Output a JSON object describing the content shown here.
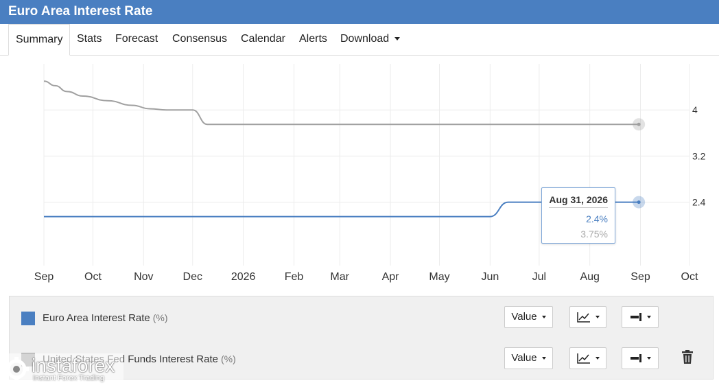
{
  "window": {
    "title": "Euro Area Interest Rate"
  },
  "tabs": [
    {
      "label": "Summary",
      "active": true
    },
    {
      "label": "Stats"
    },
    {
      "label": "Forecast"
    },
    {
      "label": "Consensus"
    },
    {
      "label": "Calendar"
    },
    {
      "label": "Alerts"
    },
    {
      "label": "Download",
      "has_dropdown": true
    }
  ],
  "chart_data": {
    "type": "line",
    "x_tick_labels": [
      "Sep",
      "Oct",
      "Nov",
      "Dec",
      "2026",
      "Feb",
      "Mar",
      "Apr",
      "May",
      "Jun",
      "Jul",
      "Aug",
      "Sep",
      "Oct"
    ],
    "y_tick_labels": [
      "4",
      "3.2",
      "2.4"
    ],
    "y_ticks": [
      4,
      3.2,
      2.4
    ],
    "ylim": [
      1.3,
      4.8
    ],
    "y_axis_side": "right",
    "grid": true,
    "series": [
      {
        "name": "Euro Area Interest Rate",
        "color": "#4a7fc1",
        "points": [
          [
            "2025-09-01",
            2.15
          ],
          [
            "2026-06-01",
            2.15
          ],
          [
            "2026-06-12",
            2.4
          ],
          [
            "2026-08-31",
            2.4
          ]
        ]
      },
      {
        "name": "United States Fed Funds Interest Rate",
        "color": "#a0a0a0",
        "points": [
          [
            "2025-09-01",
            4.5
          ],
          [
            "2025-09-08",
            4.42
          ],
          [
            "2025-09-15",
            4.32
          ],
          [
            "2025-09-25",
            4.24
          ],
          [
            "2025-10-10",
            4.16
          ],
          [
            "2025-10-25",
            4.08
          ],
          [
            "2025-11-05",
            4.02
          ],
          [
            "2025-11-15",
            4.0
          ],
          [
            "2025-12-01",
            4.0
          ],
          [
            "2025-12-10",
            3.75
          ],
          [
            "2026-08-31",
            3.75
          ]
        ]
      }
    ],
    "tooltip": {
      "date": "Aug 31, 2026",
      "values": [
        {
          "series": "Euro Area Interest Rate",
          "text": "2.4%",
          "color": "#4a7fc1"
        },
        {
          "series": "United States Fed Funds Interest Rate",
          "text": "3.75%",
          "color": "#aaaaaa"
        }
      ]
    }
  },
  "legend": [
    {
      "name": "Euro Area Interest Rate",
      "unit": "(%)",
      "color": "#4a7fc1",
      "value_label": "Value",
      "deletable": false
    },
    {
      "name": "United States Fed Funds Interest Rate",
      "unit": "(%)",
      "color": "#a0a0a0",
      "value_label": "Value",
      "deletable": true
    }
  ],
  "icons": {
    "chart_type": "line-chart-icon",
    "axis": "axis-side-icon",
    "delete": "trash-icon"
  },
  "watermark": {
    "name": "instaforex",
    "tagline": "Instant Forex Trading"
  }
}
